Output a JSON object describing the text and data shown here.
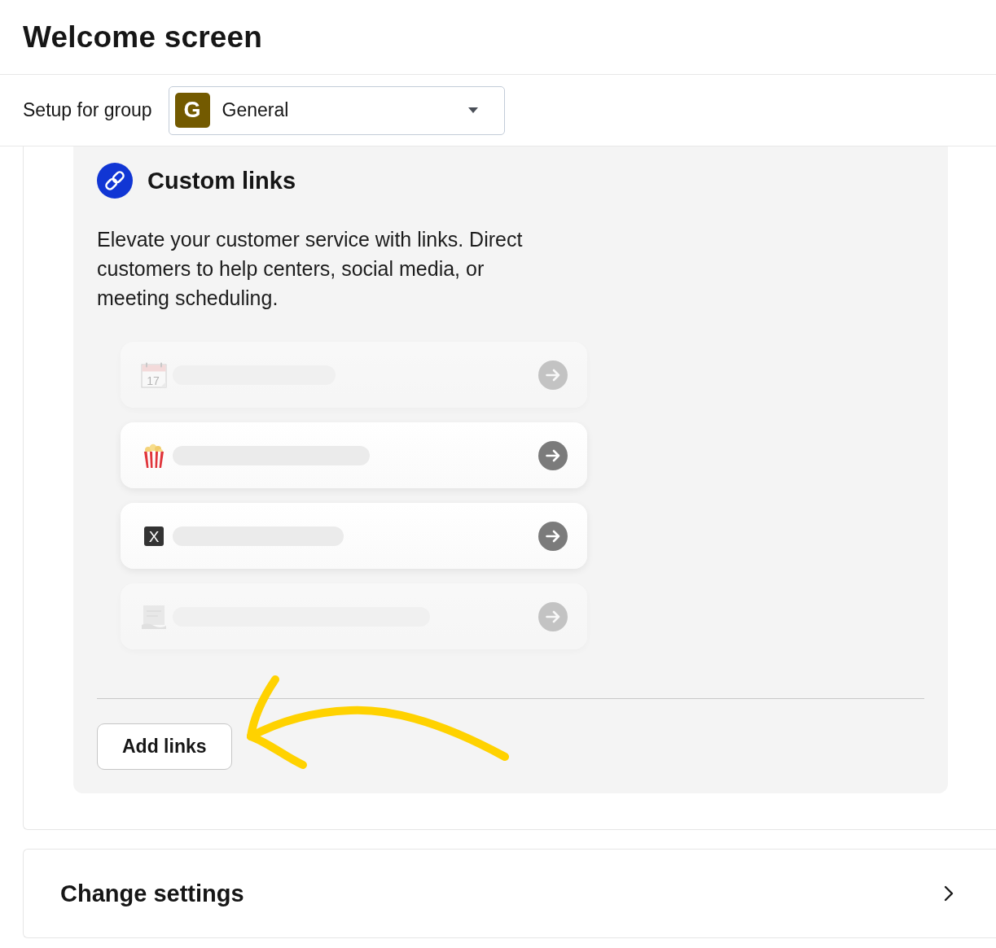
{
  "header": {
    "title": "Welcome screen"
  },
  "group_select": {
    "label": "Setup for group",
    "avatar_letter": "G",
    "value": "General"
  },
  "custom_links": {
    "title": "Custom links",
    "description": "Elevate your customer service with links. Direct customers to help centers, social media, or meeting scheduling.",
    "preview_cards": [
      {
        "kind": "calendar",
        "icon_text": "17",
        "faded": true
      },
      {
        "kind": "popcorn",
        "faded": false
      },
      {
        "kind": "x",
        "icon_text": "X",
        "faded": false
      },
      {
        "kind": "scroll",
        "faded": true
      }
    ],
    "button": "Add links"
  },
  "settings_row": {
    "title": "Change settings"
  }
}
